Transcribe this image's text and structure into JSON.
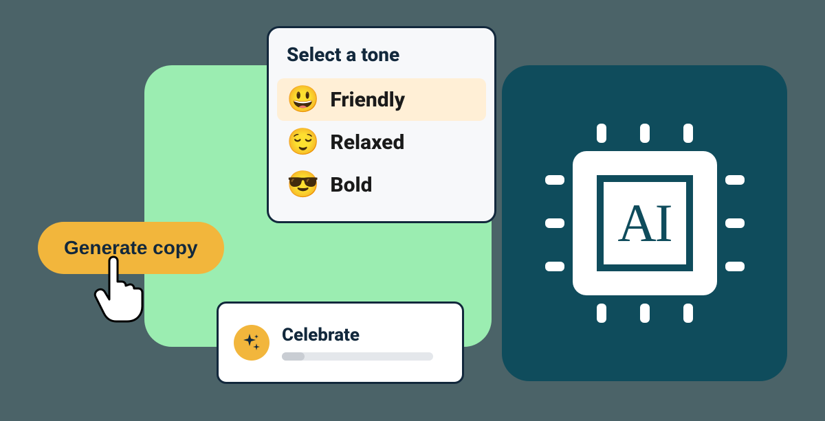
{
  "generate_button": {
    "label": "Generate copy"
  },
  "tone_popover": {
    "title": "Select a tone",
    "options": [
      {
        "emoji": "😃",
        "label": "Friendly",
        "selected": true
      },
      {
        "emoji": "😌",
        "label": "Relaxed",
        "selected": false
      },
      {
        "emoji": "😎",
        "label": "Bold",
        "selected": false
      }
    ]
  },
  "celebrate_card": {
    "label": "Celebrate"
  },
  "ai_chip": {
    "label": "AI"
  }
}
